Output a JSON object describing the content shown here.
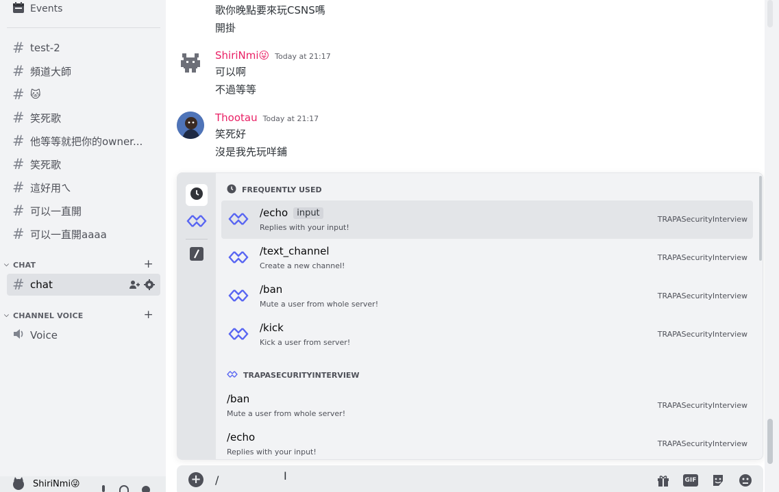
{
  "sidebar": {
    "events_label": "Events",
    "channels": [
      {
        "label": "test-2"
      },
      {
        "label": "頻道大師"
      },
      {
        "label": "🐱"
      },
      {
        "label": "笑死歌"
      },
      {
        "label": "他等等就把你的owner..."
      },
      {
        "label": "笑死歌"
      },
      {
        "label": "這好用ㄟ"
      },
      {
        "label": "可以一直開"
      },
      {
        "label": "可以一直開aaaa"
      }
    ],
    "category_chat": "CHAT",
    "active_channel": "chat",
    "category_voice": "CHANNEL VOICE",
    "voice_channel": "Voice",
    "user": {
      "name": "ShiriNmi😜"
    }
  },
  "messages": {
    "prev_lines": [
      "歌你晚點要來玩CSNS嗎",
      "開掛"
    ],
    "groups": [
      {
        "author": "ShiriNmi😜",
        "author_color": "#e91e63",
        "time": "Today at 21:17",
        "lines": [
          "可以啊",
          "不過等等"
        ]
      },
      {
        "author": "Thootau",
        "author_color": "#e91e63",
        "time": "Today at 21:17",
        "lines": [
          "笑死好",
          "沒是我先玩咩鋪"
        ]
      }
    ]
  },
  "popup": {
    "section_frequent": "FREQUENTLY USED",
    "frequent": [
      {
        "name": "/echo",
        "option": "input",
        "desc": "Replies with your input!",
        "source": "TRAPASecurityInterview"
      },
      {
        "name": "/text_channel",
        "desc": "Create a new channel!",
        "source": "TRAPASecurityInterview"
      },
      {
        "name": "/ban",
        "desc": "Mute a user from whole server!",
        "source": "TRAPASecurityInterview"
      },
      {
        "name": "/kick",
        "desc": "Kick a user from server!",
        "source": "TRAPASecurityInterview"
      }
    ],
    "section_app": "TRAPASECURITYINTERVIEW",
    "app": [
      {
        "name": "/ban",
        "desc": "Mute a user from whole server!",
        "source": "TRAPASecurityInterview"
      },
      {
        "name": "/echo",
        "desc": "Replies with your input!",
        "source": "TRAPASecurityInterview"
      }
    ]
  },
  "composer": {
    "value": "/"
  },
  "colors": {
    "accent": "#5865f2",
    "mention": "#e91e63"
  }
}
